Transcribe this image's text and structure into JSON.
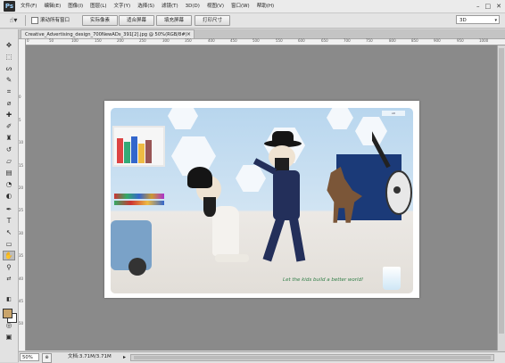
{
  "app": {
    "logo": "Ps"
  },
  "menu": [
    "文件(F)",
    "编辑(E)",
    "图像(I)",
    "图层(L)",
    "文字(Y)",
    "选择(S)",
    "滤镜(T)",
    "3D(D)",
    "视图(V)",
    "窗口(W)",
    "帮助(H)"
  ],
  "window_controls": {
    "minimize": "–",
    "restore": "□",
    "close": "✕"
  },
  "options": {
    "tool_glyph": "☝▾",
    "scroll_all_label": "滚动所有窗口",
    "buttons": [
      "实际像素",
      "适合屏幕",
      "填充屏幕",
      "打印尺寸"
    ],
    "workspace": "3D",
    "workspace_arrow": "▾"
  },
  "tabs": [
    {
      "label": "Creative_Advertising_design_700NewADs_391[2].jpg @ 50%(RGB/8#)",
      "close": "×"
    }
  ],
  "ruler_top": [
    "0",
    "50",
    "100",
    "150",
    "200",
    "250",
    "300",
    "350",
    "400",
    "450",
    "500",
    "550",
    "600",
    "650",
    "700",
    "750",
    "800",
    "850",
    "900",
    "950",
    "1000"
  ],
  "ruler_left": [
    "0",
    "5",
    "10",
    "15",
    "20",
    "25",
    "30",
    "35",
    "40",
    "45",
    "50"
  ],
  "tools": [
    {
      "name": "move-tool-icon",
      "glyph": "✥"
    },
    {
      "name": "marquee-tool-icon",
      "glyph": "⬚"
    },
    {
      "name": "lasso-tool-icon",
      "glyph": "ᔕ"
    },
    {
      "name": "quick-select-tool-icon",
      "glyph": "✎"
    },
    {
      "name": "crop-tool-icon",
      "glyph": "⌗"
    },
    {
      "name": "eyedropper-tool-icon",
      "glyph": "⌀"
    },
    {
      "name": "healing-brush-tool-icon",
      "glyph": "✚"
    },
    {
      "name": "brush-tool-icon",
      "glyph": "✐"
    },
    {
      "name": "clone-stamp-tool-icon",
      "glyph": "♜"
    },
    {
      "name": "history-brush-tool-icon",
      "glyph": "↺"
    },
    {
      "name": "eraser-tool-icon",
      "glyph": "▱"
    },
    {
      "name": "gradient-tool-icon",
      "glyph": "▤"
    },
    {
      "name": "blur-tool-icon",
      "glyph": "◔"
    },
    {
      "name": "dodge-tool-icon",
      "glyph": "◐"
    },
    {
      "name": "pen-tool-icon",
      "glyph": "✒"
    },
    {
      "name": "type-tool-icon",
      "glyph": "T"
    },
    {
      "name": "path-select-tool-icon",
      "glyph": "↖"
    },
    {
      "name": "shape-tool-icon",
      "glyph": "▭"
    },
    {
      "name": "hand-tool-icon",
      "glyph": "✋"
    },
    {
      "name": "zoom-tool-icon",
      "glyph": "⚲"
    }
  ],
  "extra_tools": {
    "swap": "⇄",
    "reset": "◧",
    "quickmask": "◎",
    "screenmode": "▣"
  },
  "artwork": {
    "brand_tag": "AD",
    "slogan": "Let the kids build a better world!"
  },
  "status": {
    "zoom": "50%",
    "icon": "⊕",
    "doc_info": "文档:3.71M/3.71M",
    "arrow": "▸"
  },
  "colors": {
    "foreground": "#c9a46a",
    "background": "#ffffff",
    "pasteboard": "#8a8a8a"
  }
}
